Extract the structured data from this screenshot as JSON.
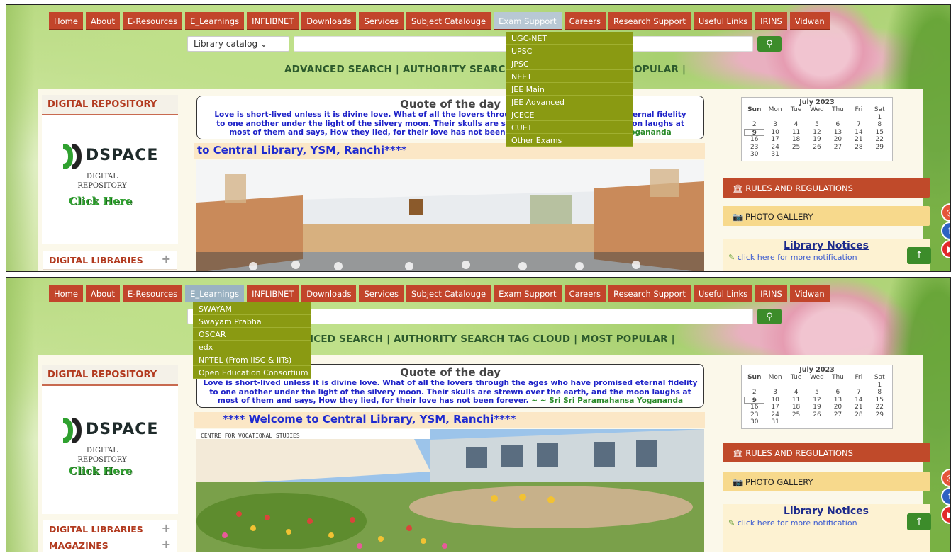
{
  "nav": {
    "items": [
      "Home",
      "About",
      "E-Resources",
      "E_Learnings",
      "INFLIBNET",
      "Downloads",
      "Services",
      "Subject Catalouge",
      "Exam Support",
      "Careers",
      "Research Support",
      "Useful Links",
      "IRINS",
      "Vidwan"
    ]
  },
  "exam_support_menu": [
    "UGC-NET",
    "UPSC",
    "JPSC",
    "NEET",
    "JEE Main",
    "JEE Advanced",
    "JCECE",
    "CUET",
    "Other Exams"
  ],
  "elearnings_menu": [
    "SWAYAM",
    "Swayam Prabha",
    "OSCAR",
    "edx",
    "NPTEL (From IISC & IITs)",
    "Open Education Consortium"
  ],
  "search": {
    "catalog_option": "Library catalog",
    "advanced_links_full": "ADVANCED SEARCH | AUTHORITY SEARCH TAG CLOUD | MOST POPULAR |",
    "advanced_links_left": "ADVANCED SEARCH | AUTHORITY SEARC",
    "advanced_links_right": "POPULAR |",
    "advanced_links_tail": "ICED SEARCH | AUTHORITY SEARCH TAG CLOUD | MOST POPULAR |"
  },
  "left": {
    "repo_title": "DIGITAL REPOSITORY",
    "dspace_word": "DSPACE",
    "dspace_sub": "DIGITAL\nREPOSITORY",
    "click_here": "Click Here",
    "digital_libraries": "DIGITAL LIBRARIES",
    "magazines": "MAGAZINES"
  },
  "quote": {
    "title": "Quote of the day",
    "text": "Love is short-lived unless it is divine love. What of all the lovers through the ages who have promised eternal fidelity to one another under the light of the silvery moon. Their skulls are strewn over the earth, and the moon laughs at most of them and says, How they lied, for their love has not been forever.",
    "author": "~ ~ Sri Sri Paramahansa Yogananda",
    "line1_part": "Love is short-lived unless it is divine love. What of all the lovers throug",
    "line1_tail": "eternal fidelity",
    "line2_part": "to one another under the light of the silvery moon. Their skulls are str",
    "line2_tail": "noon laughs at",
    "line3_part": "most of them and says, How they lied, for their love has not been fo",
    "line3_tail": "Yogananda"
  },
  "welcome": {
    "partial": "to Central Library, YSM, Ranchi****",
    "full": "**** Welcome to Central Library, YSM, Ranchi****"
  },
  "calendar": {
    "title": "July 2023",
    "headers": [
      "Sun",
      "Mon",
      "Tue",
      "Wed",
      "Thu",
      "Fri",
      "Sat"
    ],
    "days": [
      "",
      "",
      "",
      "",
      "",
      "",
      "1",
      "2",
      "3",
      "4",
      "5",
      "6",
      "7",
      "8",
      "9",
      "10",
      "11",
      "12",
      "13",
      "14",
      "15",
      "16",
      "17",
      "18",
      "19",
      "20",
      "21",
      "22",
      "23",
      "24",
      "25",
      "26",
      "27",
      "28",
      "29",
      "30",
      "31",
      "",
      "",
      "",
      "",
      ""
    ],
    "today": "9"
  },
  "right": {
    "rules": "RULES AND REGULATIONS",
    "gallery": "PHOTO GALLERY",
    "notices_title": "Library Notices",
    "notices_link": "click here for more notification"
  },
  "photo": {
    "building_sign": "CENTRE FOR VOCATIONAL STUDIES"
  },
  "icons": {
    "search": "search-icon",
    "up": "arrow-up-icon",
    "bank": "institution-icon",
    "camera": "camera-icon",
    "edit": "edit-icon",
    "instagram": "instagram-icon",
    "facebook": "facebook-icon",
    "youtube": "youtube-icon"
  },
  "colors": {
    "nav": "#c2452b",
    "nav_active": "#b8c8d4",
    "dropdown": "#8a9a12",
    "accent_green": "#3c8c2a",
    "title_red": "#b23a1f",
    "quote_blue": "#1e22c8"
  }
}
